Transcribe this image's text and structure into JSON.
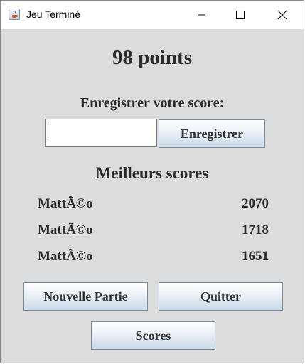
{
  "window": {
    "title": "Jeu Terminé",
    "icon": "java-app-icon"
  },
  "result": {
    "points_label": "98 points"
  },
  "save": {
    "label": "Enregistrer votre score:",
    "input_value": "",
    "button_label": "Enregistrer"
  },
  "leaderboard": {
    "title": "Meilleurs scores",
    "entries": [
      {
        "name": "MattÃ©o",
        "score": "2070"
      },
      {
        "name": "MattÃ©o",
        "score": "1718"
      },
      {
        "name": "MattÃ©o",
        "score": "1651"
      }
    ]
  },
  "actions": {
    "new_game": "Nouvelle Partie",
    "quit": "Quitter",
    "scores": "Scores"
  },
  "background": {
    "top_number": "2070"
  },
  "colors": {
    "dialog_bg": "#dcdcdc",
    "text": "#2a2a2a",
    "background_app_stripe": "#2a00c8"
  }
}
